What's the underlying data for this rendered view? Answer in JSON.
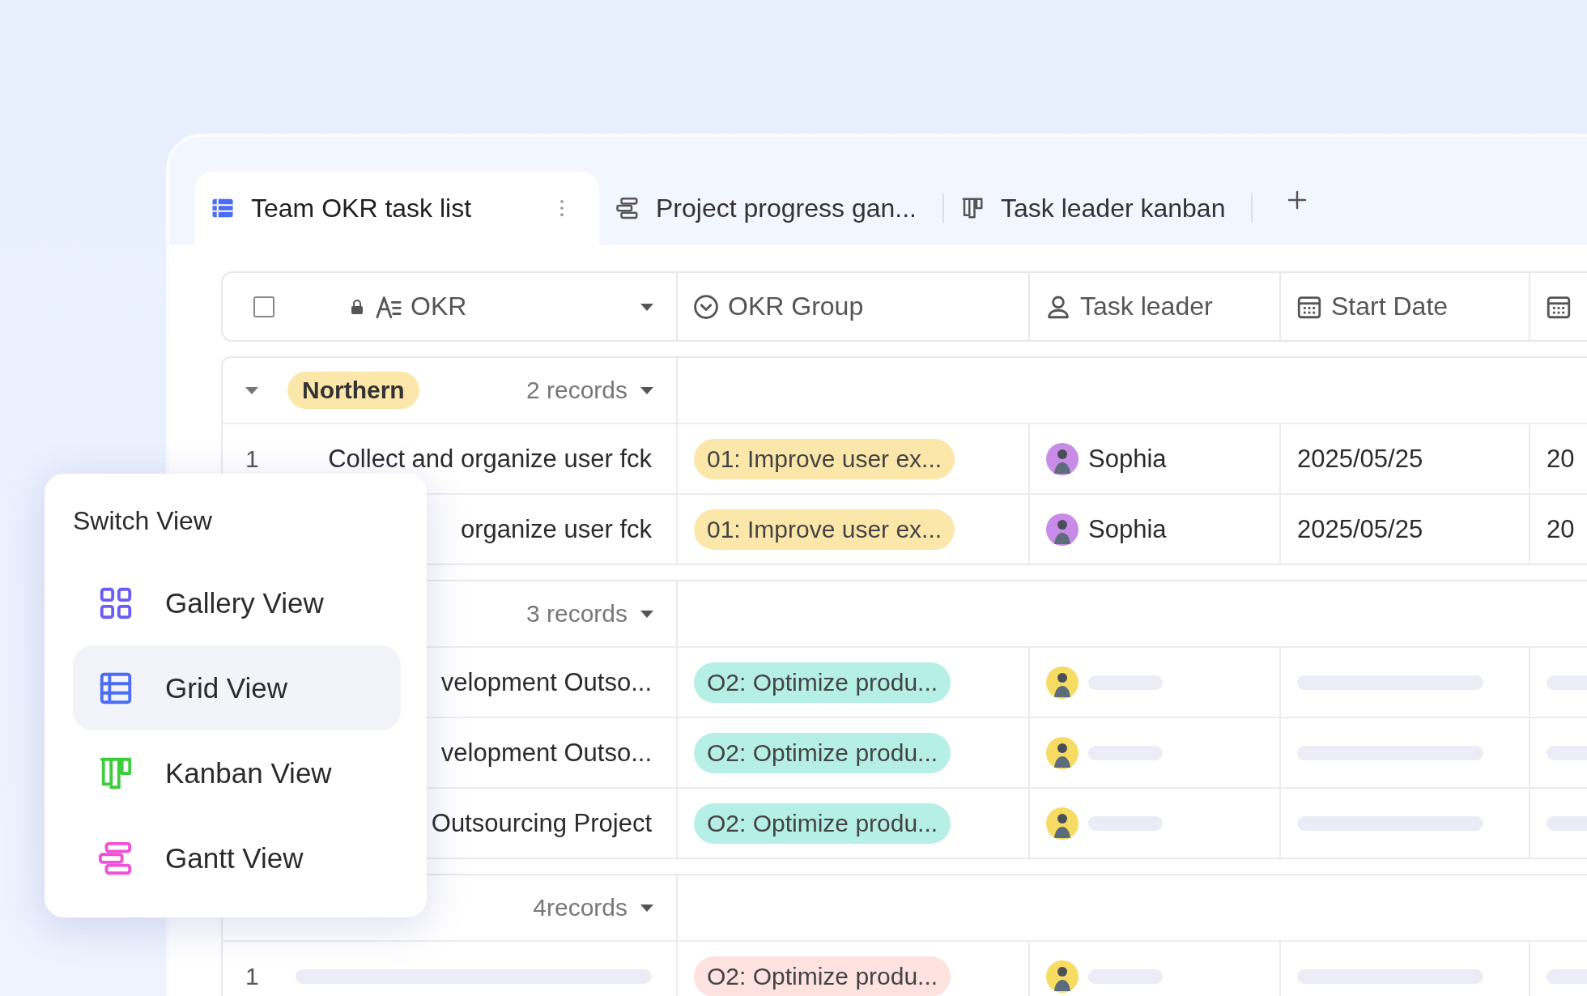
{
  "tabs": [
    {
      "label": "Team OKR task list",
      "selected": true
    },
    {
      "label": "Project progress gan...",
      "selected": false
    },
    {
      "label": "Task leader kanban",
      "selected": false
    }
  ],
  "table": {
    "select_all": {
      "checked": false
    },
    "columns": [
      {
        "label": "OKR"
      },
      {
        "label": "OKR Group"
      },
      {
        "label": "Task leader"
      },
      {
        "label": "Start Date"
      }
    ],
    "groups": [
      {
        "expanded": true,
        "tag": {
          "label": "Northern",
          "color": "#fbe7a9"
        },
        "count": "2 records",
        "rows": [
          {
            "number": "1",
            "okr": "Collect and organize user fck",
            "okr_group": {
              "label": "01: Improve user ex...",
              "color": "#fbe7a9"
            },
            "leader": {
              "name": "Sophia",
              "color": "#c98be8"
            },
            "start_date": "2025/05/25",
            "column_5": "20"
          },
          {
            "okr": "organize user fck",
            "okr_group": {
              "label": "01: Improve user ex...",
              "color": "#fbe7a9"
            },
            "leader": {
              "name": "Sophia",
              "color": "#c98be8"
            },
            "start_date": "2025/05/25",
            "column_5": "20"
          }
        ]
      },
      {
        "count": "3 records",
        "rows": [
          {
            "okr": "velopment Outso...",
            "okr_group": {
              "label": "O2: Optimize produ...",
              "color": "#b5efe6"
            },
            "leader": {
              "color": "#f7dc63"
            }
          },
          {
            "okr": "velopment Outso...",
            "okr_group": {
              "label": "O2: Optimize produ...",
              "color": "#b5efe6"
            },
            "leader": {
              "color": "#f7dc63"
            }
          },
          {
            "okr": "Outsourcing Project",
            "okr_group": {
              "label": "O2: Optimize produ...",
              "color": "#b5efe6"
            },
            "leader": {
              "color": "#f7dc63"
            }
          }
        ]
      },
      {
        "count": "4records",
        "rows": [
          {
            "number": "1",
            "okr_group": {
              "label": "O2: Optimize produ...",
              "color": "#fde2df"
            },
            "leader": {
              "color": "#f7dc63"
            }
          }
        ]
      }
    ]
  },
  "switch_view": {
    "title": "Switch View",
    "items": [
      {
        "label": "Gallery View",
        "selected": false
      },
      {
        "label": "Grid View",
        "selected": true
      },
      {
        "label": "Kanban View",
        "selected": false
      },
      {
        "label": "Gantt View",
        "selected": false
      }
    ]
  }
}
